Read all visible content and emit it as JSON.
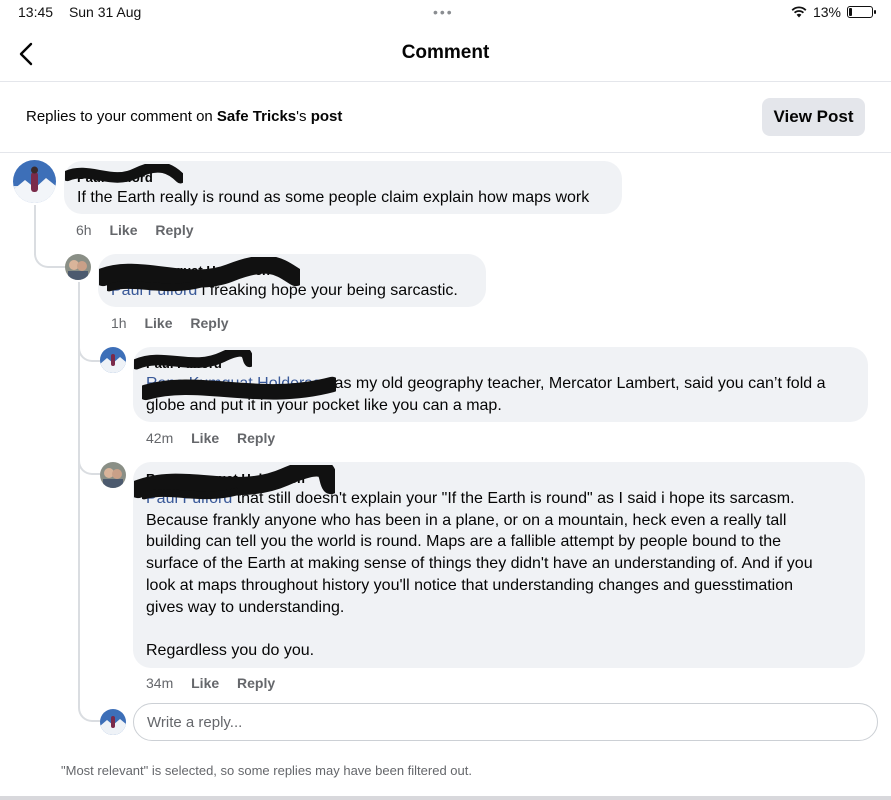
{
  "status": {
    "time": "13:45",
    "date": "Sun 31 Aug",
    "battery": "13%",
    "battery_level": 0.13
  },
  "header": {
    "title": "Comment"
  },
  "context": {
    "prefix": "Replies to your comment on ",
    "page": "Safe Tricks",
    "suffix": "'s",
    "post": "post"
  },
  "view_post_label": "View Post",
  "comments": [
    {
      "author": "Paul Fulford",
      "text": "If the Earth really is round as some people claim explain how maps work",
      "time": "6h",
      "like": "Like",
      "reply": "Reply"
    },
    {
      "author": "Rene Kumquat Holdersen",
      "mention": "Paul Fulford",
      "text": "i freaking hope your being sarcastic.",
      "time": "1h",
      "like": "Like",
      "reply": "Reply"
    },
    {
      "author": "Paul Fulford",
      "mention": "Rene Kumquat Holdersen",
      "text_line1": " as my old geography teacher, Mercator Lambert, said you can’t fold a",
      "text_line2": "globe and put it in your pocket like you can a map.",
      "time": "42m",
      "like": "Like",
      "reply": "Reply"
    },
    {
      "author": "Rene Kumquat Holdersen",
      "mention": "Paul Fulford",
      "text_line1": " that still doesn't explain your \"If the Earth is round\" as I said i hope its sarcasm.",
      "text_lines": [
        "Because frankly anyone who has been in a plane, or on a mountain,  heck even a really tall",
        "building can tell you the world is round. Maps are a fallible attempt by people bound to the",
        "surface of the Earth at making sense of things they didn't have an understanding of.  And if you",
        "look at maps throughout history you'll notice that understanding changes and guesstimation",
        "gives way to understanding."
      ],
      "text_last": "Regardless you do you.",
      "time": "34m",
      "like": "Like",
      "reply": "Reply"
    }
  ],
  "reply_input": {
    "placeholder": "Write a reply..."
  },
  "filter_note": "\"Most relevant\" is selected, so some replies may have been filtered out."
}
